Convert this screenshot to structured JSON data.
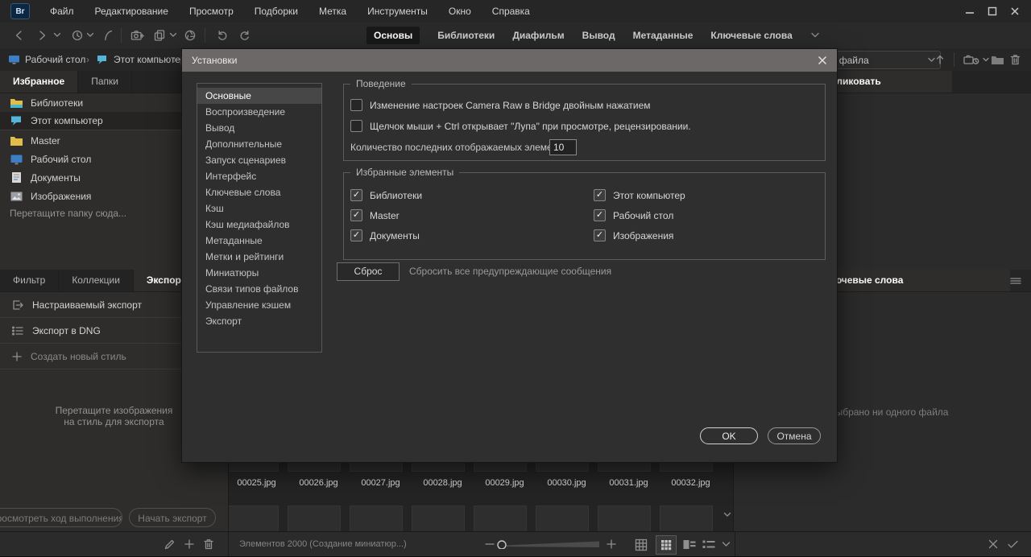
{
  "titlebar": {
    "app_badge": "Br",
    "menus": [
      "Файл",
      "Редактирование",
      "Просмотр",
      "Подборки",
      "Метка",
      "Инструменты",
      "Окно",
      "Справка"
    ]
  },
  "toolbar": {
    "workspace_tabs": [
      "Основы",
      "Библиотеки",
      "Диафильм",
      "Вывод",
      "Метаданные",
      "Ключевые слова"
    ],
    "active_tab": "Основы",
    "search_value": ""
  },
  "breadcrumb": {
    "items": [
      "Рабочий стол",
      "Этот компьютер"
    ]
  },
  "sort_bar": {
    "sort_value": "Имя файла"
  },
  "left_panel": {
    "tabs": [
      "Избранное",
      "Папки"
    ],
    "active_tab": "Избранное",
    "favorites": [
      "Библиотеки",
      "Этот компьютер",
      "Master",
      "Рабочий стол",
      "Документы",
      "Изображения"
    ],
    "selected_favorite": "Этот компьютер",
    "drop_hint": "Перетащите папку сюда...",
    "lower_tabs": [
      "Фильтр",
      "Коллекции",
      "Экспорт"
    ],
    "active_lower_tab": "Экспорт",
    "export_items": [
      "Настраиваемый экспорт",
      "Экспорт в DNG",
      "Создать новый стиль"
    ],
    "export_drop_hint_line1": "Перетащите изображения",
    "export_drop_hint_line2": "на стиль для экспорта",
    "progress_button": "Просмотреть ход выполнения",
    "start_export_button": "Начать экспорт"
  },
  "content": {
    "files": [
      "00025.jpg",
      "00026.jpg",
      "00027.jpg",
      "00028.jpg",
      "00029.jpg",
      "00030.jpg",
      "00031.jpg",
      "00032.jpg"
    ],
    "status_text": "Элементов 2000 (Создание миниатюр...)"
  },
  "right_panel": {
    "publish_header": "Опубликовать",
    "keywords_header": "Ключевые слова",
    "empty_message": "Не выбрано ни одного файла"
  },
  "dialog": {
    "title": "Установки",
    "nav_items": [
      "Основные",
      "Воспроизведение",
      "Вывод",
      "Дополнительные",
      "Запуск сценариев",
      "Интерфейс",
      "Ключевые слова",
      "Кэш",
      "Кэш медиафайлов",
      "Метаданные",
      "Метки и рейтинги",
      "Миниатюры",
      "Связи типов файлов",
      "Управление кэшем",
      "Экспорт"
    ],
    "active_nav_item": "Основные",
    "behavior": {
      "legend": "Поведение",
      "checkbox1": "Изменение настроек Camera Raw в Bridge двойным нажатием",
      "checkbox1_checked": false,
      "checkbox2": "Щелчок мыши + Ctrl открывает \"Лупа\" при просмотре, рецензировании.",
      "checkbox2_checked": false,
      "recent_label": "Количество последних отображаемых элементов",
      "recent_value": "10"
    },
    "favorites_group": {
      "legend": "Избранные элементы",
      "left": [
        {
          "label": "Библиотеки",
          "checked": true
        },
        {
          "label": "Master",
          "checked": true
        },
        {
          "label": "Документы",
          "checked": true
        }
      ],
      "right": [
        {
          "label": "Этот компьютер",
          "checked": true
        },
        {
          "label": "Рабочий стол",
          "checked": true
        },
        {
          "label": "Изображения",
          "checked": true
        }
      ]
    },
    "reset_button": "Сброс",
    "reset_note": "Сбросить все предупреждающие сообщения",
    "ok_button": "OK",
    "cancel_button": "Отмена"
  },
  "colors": {
    "dialog_titlebar": "#6b6867",
    "selection": "#474747",
    "panel_bg": "#2e2d2c",
    "window_bg": "#282828"
  }
}
